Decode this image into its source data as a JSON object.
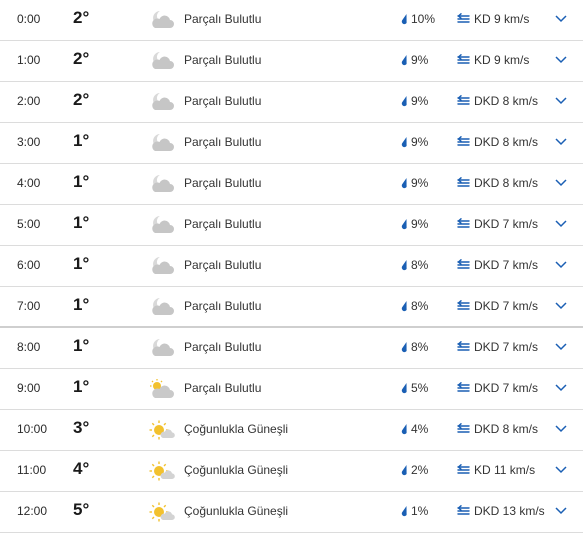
{
  "colors": {
    "accent": "#1a5fb4",
    "divider": "#dcdcdc",
    "text": "#333333"
  },
  "hours": [
    {
      "time": "0:00",
      "temp": "2°",
      "icon": "cloud-moon-icon",
      "condition": "Parçalı Bulutlu",
      "precip": "10%",
      "wind": "KD 9 km/s"
    },
    {
      "time": "1:00",
      "temp": "2°",
      "icon": "cloud-moon-icon",
      "condition": "Parçalı Bulutlu",
      "precip": "9%",
      "wind": "KD 9 km/s"
    },
    {
      "time": "2:00",
      "temp": "2°",
      "icon": "cloud-moon-icon",
      "condition": "Parçalı Bulutlu",
      "precip": "9%",
      "wind": "DKD 8 km/s"
    },
    {
      "time": "3:00",
      "temp": "1°",
      "icon": "cloud-moon-icon",
      "condition": "Parçalı Bulutlu",
      "precip": "9%",
      "wind": "DKD 8 km/s"
    },
    {
      "time": "4:00",
      "temp": "1°",
      "icon": "cloud-moon-icon",
      "condition": "Parçalı Bulutlu",
      "precip": "9%",
      "wind": "DKD 8 km/s"
    },
    {
      "time": "5:00",
      "temp": "1°",
      "icon": "cloud-moon-icon",
      "condition": "Parçalı Bulutlu",
      "precip": "9%",
      "wind": "DKD 7 km/s"
    },
    {
      "time": "6:00",
      "temp": "1°",
      "icon": "cloud-moon-icon",
      "condition": "Parçalı Bulutlu",
      "precip": "8%",
      "wind": "DKD 7 km/s"
    },
    {
      "time": "7:00",
      "temp": "1°",
      "icon": "cloud-moon-icon",
      "condition": "Parçalı Bulutlu",
      "precip": "8%",
      "wind": "DKD 7 km/s"
    },
    {
      "time": "8:00",
      "temp": "1°",
      "icon": "cloud-moon-icon",
      "condition": "Parçalı Bulutlu",
      "precip": "8%",
      "wind": "DKD 7 km/s"
    },
    {
      "time": "9:00",
      "temp": "1°",
      "icon": "cloud-sun-icon",
      "condition": "Parçalı Bulutlu",
      "precip": "5%",
      "wind": "DKD 7 km/s"
    },
    {
      "time": "10:00",
      "temp": "3°",
      "icon": "sun-icon",
      "condition": "Çoğunlukla Güneşli",
      "precip": "4%",
      "wind": "DKD 8 km/s"
    },
    {
      "time": "11:00",
      "temp": "4°",
      "icon": "sun-icon",
      "condition": "Çoğunlukla Güneşli",
      "precip": "2%",
      "wind": "KD 11 km/s"
    },
    {
      "time": "12:00",
      "temp": "5°",
      "icon": "sun-icon",
      "condition": "Çoğunlukla Güneşli",
      "precip": "1%",
      "wind": "DKD 13 km/s"
    }
  ]
}
